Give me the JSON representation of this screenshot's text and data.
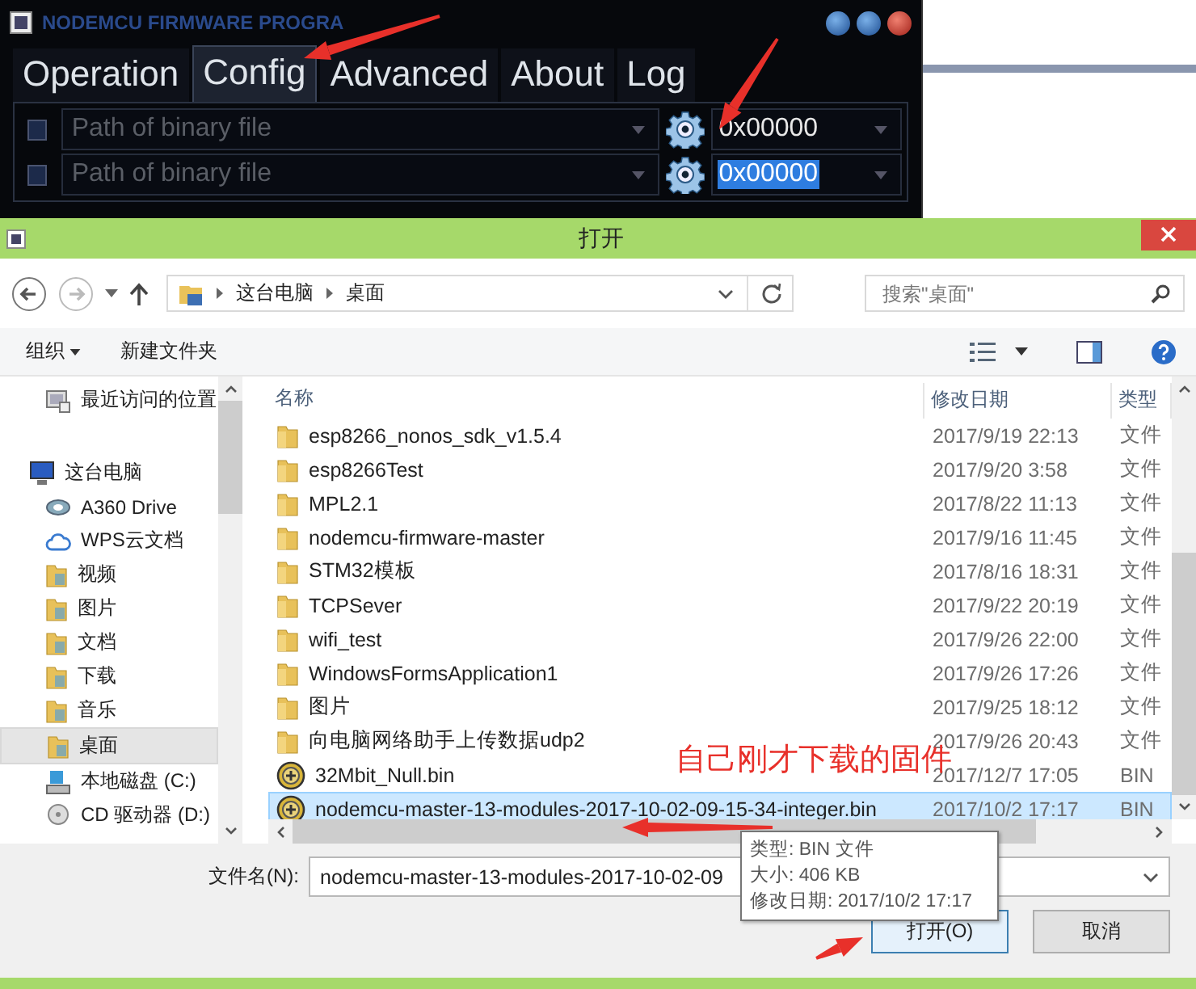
{
  "app_window": {
    "title": "NODEMCU FIRMWARE PROGRA",
    "tabs": [
      {
        "label": "Operation",
        "selected": false
      },
      {
        "label": "Config",
        "selected": true
      },
      {
        "label": "Advanced",
        "selected": false
      },
      {
        "label": "About",
        "selected": false
      },
      {
        "label": "Log",
        "selected": false
      }
    ],
    "file_rows": [
      {
        "checked": false,
        "placeholder": "Path of binary file",
        "offset": "0x00000",
        "offset_selected": false
      },
      {
        "checked": false,
        "placeholder": "Path of binary file",
        "offset": "0x00000",
        "offset_selected": true
      }
    ]
  },
  "dialog": {
    "title": "打开",
    "breadcrumbs": [
      "这台电脑",
      "桌面"
    ],
    "search": {
      "placeholder": "搜索\"桌面\""
    },
    "toolbar": {
      "organize": "组织",
      "new_folder": "新建文件夹"
    },
    "sidebar": {
      "items": [
        {
          "label": "最近访问的位置",
          "kind": "recent",
          "selected": false
        },
        {
          "label": "这台电脑",
          "kind": "computer",
          "selected": false,
          "children": [
            {
              "label": "A360 Drive",
              "kind": "drive-link",
              "selected": false
            },
            {
              "label": "WPS云文档",
              "kind": "cloud",
              "selected": false
            },
            {
              "label": "视频",
              "kind": "folder",
              "selected": false
            },
            {
              "label": "图片",
              "kind": "folder",
              "selected": false
            },
            {
              "label": "文档",
              "kind": "folder",
              "selected": false
            },
            {
              "label": "下载",
              "kind": "folder",
              "selected": false
            },
            {
              "label": "音乐",
              "kind": "folder",
              "selected": false
            },
            {
              "label": "桌面",
              "kind": "folder",
              "selected": true
            },
            {
              "label": "本地磁盘 (C:)",
              "kind": "disk",
              "selected": false
            },
            {
              "label": "CD 驱动器 (D:)",
              "kind": "cd",
              "selected": false
            }
          ]
        }
      ]
    },
    "columns": [
      "名称",
      "修改日期",
      "类型"
    ],
    "files": [
      {
        "name": "esp8266_nonos_sdk_v1.5.4",
        "date": "2017/9/19 22:13",
        "type": "文件",
        "kind": "folder",
        "selected": false
      },
      {
        "name": "esp8266Test",
        "date": "2017/9/20 3:58",
        "type": "文件",
        "kind": "folder",
        "selected": false
      },
      {
        "name": "MPL2.1",
        "date": "2017/8/22 11:13",
        "type": "文件",
        "kind": "folder",
        "selected": false
      },
      {
        "name": "nodemcu-firmware-master",
        "date": "2017/9/16 11:45",
        "type": "文件",
        "kind": "folder",
        "selected": false
      },
      {
        "name": "STM32模板",
        "date": "2017/8/16 18:31",
        "type": "文件",
        "kind": "folder",
        "selected": false
      },
      {
        "name": "TCPSever",
        "date": "2017/9/22 20:19",
        "type": "文件",
        "kind": "folder",
        "selected": false
      },
      {
        "name": "wifi_test",
        "date": "2017/9/26 22:00",
        "type": "文件",
        "kind": "folder",
        "selected": false
      },
      {
        "name": "WindowsFormsApplication1",
        "date": "2017/9/26 17:26",
        "type": "文件",
        "kind": "folder",
        "selected": false
      },
      {
        "name": "图片",
        "date": "2017/9/25 18:12",
        "type": "文件",
        "kind": "folder",
        "selected": false
      },
      {
        "name": "向电脑网络助手上传数据udp2",
        "date": "2017/9/26 20:43",
        "type": "文件",
        "kind": "folder",
        "selected": false
      },
      {
        "name": "32Mbit_Null.bin",
        "date": "2017/12/7 17:05",
        "type": "BIN",
        "kind": "bin",
        "selected": false
      },
      {
        "name": "nodemcu-master-13-modules-2017-10-02-09-15-34-integer.bin",
        "date": "2017/10/2 17:17",
        "type": "BIN",
        "kind": "bin",
        "selected": true
      }
    ],
    "filename_label": "文件名(N):",
    "filename_value": "nodemcu-master-13-modules-2017-10-02-09",
    "buttons": [
      {
        "label": "打开(O)",
        "kind": "primary"
      },
      {
        "label": "取消",
        "kind": "normal"
      }
    ],
    "tooltip": [
      "类型: BIN 文件",
      "大小: 406 KB",
      "修改日期: 2017/10/2 17:17"
    ]
  },
  "annotation": {
    "note": "自己刚才下载的固件"
  }
}
